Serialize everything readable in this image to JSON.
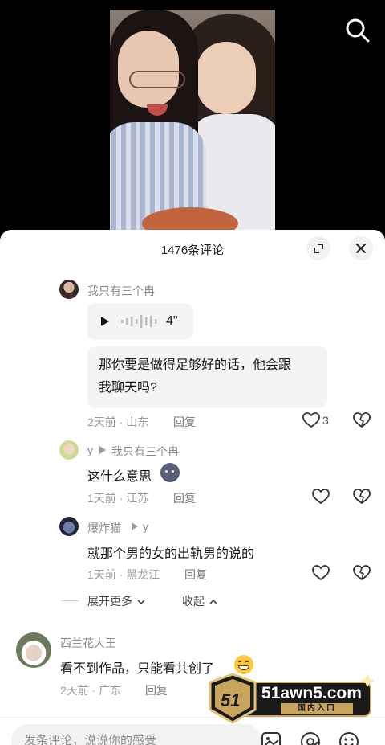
{
  "header": {
    "comment_count_title": "1476条评论"
  },
  "replies": [
    {
      "author": "我只有三个冉",
      "voice_duration": "4\"",
      "text": "那你要是做得足够好的话，他会跟我聊天吗?",
      "text_line1": "那你要是做得足够好的话，他会跟",
      "text_line2": "我聊天吗?",
      "time": "2天前 · 山东",
      "reply": "回复",
      "likes": "3"
    },
    {
      "author": "y",
      "reply_to": "我只有三个冉",
      "text": "这什么意思",
      "time": "1天前 · 江苏",
      "reply": "回复"
    },
    {
      "author": "爆炸猫",
      "reply_to": "y",
      "text": "就那个男的女的出轨男的说的",
      "time": "1天前 · 黑龙江",
      "reply": "回复"
    }
  ],
  "thread_controls": {
    "expand": "展开更多",
    "collapse": "收起"
  },
  "comment": {
    "author": "西兰花大王",
    "text": "看不到作品，只能看共创了",
    "time": "2天前 · 广东",
    "reply": "回复"
  },
  "input": {
    "placeholder": "发条评论，说说你的感受"
  },
  "watermark": {
    "brand": "51awn5.com",
    "sub": "国内入口",
    "logo": "51"
  },
  "icons": [
    "search-icon",
    "expand-icon",
    "close-icon",
    "play-icon",
    "heart-icon",
    "broken-heart-icon",
    "chevron-down-icon",
    "chevron-up-icon",
    "image-icon",
    "at-icon",
    "emoji-icon"
  ]
}
